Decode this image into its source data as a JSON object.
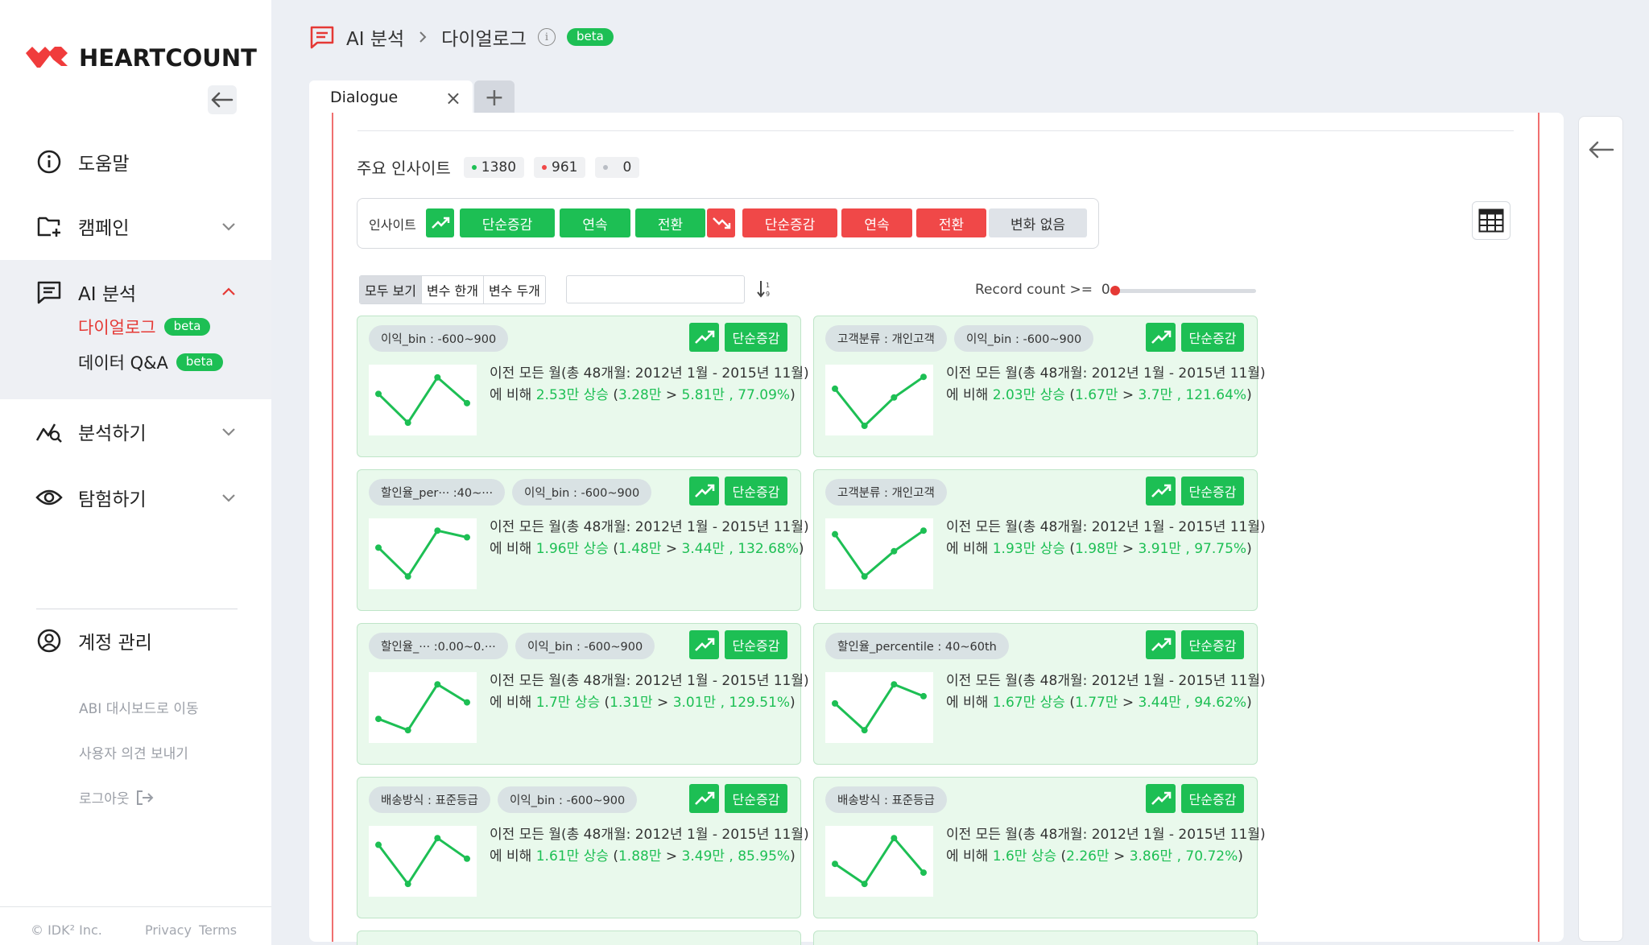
{
  "brand": {
    "name": "HEARTCOUNT",
    "red": "#f03c3c",
    "green": "#1dbf54"
  },
  "sidebar": {
    "items": [
      {
        "label": "도움말",
        "icon": "info-circle-icon"
      },
      {
        "label": "캠페인",
        "icon": "folder-plus-icon"
      },
      {
        "label": "AI 분석",
        "icon": "chat-icon"
      },
      {
        "label": "분석하기",
        "icon": "analytics-icon"
      },
      {
        "label": "탐험하기",
        "icon": "eye-icon"
      }
    ],
    "ai_sub": [
      {
        "label": "다이얼로그",
        "badge": "beta",
        "active": true
      },
      {
        "label": "데이터 Q&A",
        "badge": "beta",
        "active": false
      }
    ],
    "account": "계정 관리",
    "links": [
      "ABI 대시보드로 이동",
      "사용자 의견 보내기",
      "로그아웃"
    ],
    "footer": {
      "copyright": "© IDK² Inc.",
      "privacy": "Privacy",
      "terms": "Terms"
    }
  },
  "header": {
    "crumb1": "AI 분석",
    "crumb2": "다이얼로그",
    "badge": "beta"
  },
  "tabs": [
    {
      "label": "Dialogue"
    }
  ],
  "insights": {
    "title": "주요 인사이트",
    "counts": [
      {
        "value": "1380",
        "color": "#1dbf54"
      },
      {
        "value": "961",
        "color": "#f04848"
      },
      {
        "value": "0",
        "color": "#b9bdc4"
      }
    ],
    "filter_label": "인사이트",
    "up_filters": [
      "단순증감",
      "연속",
      "전환"
    ],
    "down_filters": [
      "단순증감",
      "연속",
      "전환"
    ],
    "none_filter": "변화 없음"
  },
  "toolbar": {
    "segments": [
      "모두 보기",
      "변수 한개",
      "변수 두개"
    ],
    "record_label": "Record count >=",
    "record_value": "0",
    "record_fraction": 0
  },
  "cards": [
    {
      "chips": [
        "이익_bin : -600~900"
      ],
      "type": "단순증감",
      "period": "이전 모든 월(총 48개월: 2012년 1월 - 2015년 11월)",
      "prefix": "에 비해 ",
      "change": "2.53만 상승",
      "open": " (",
      "from": "3.28만",
      "sep": " > ",
      "to": "5.81만 , 77.09%",
      "close": ")",
      "spark": [
        0.62,
        0.06,
        0.94,
        0.44
      ]
    },
    {
      "chips": [
        "고객분류 : 개인고객",
        "이익_bin : -600~900"
      ],
      "type": "단순증감",
      "period": "이전 모든 월(총 48개월: 2012년 1월 - 2015년 11월)",
      "prefix": "에 비해 ",
      "change": "2.03만 상승",
      "open": " (",
      "from": "1.67만",
      "sep": " > ",
      "to": "3.7만 , 121.64%",
      "close": ")",
      "spark": [
        0.72,
        0.0,
        0.55,
        0.95
      ]
    },
    {
      "chips": [
        "할인율_per···  :40~···",
        "이익_bin : -600~900"
      ],
      "type": "단순증감",
      "period": "이전 모든 월(총 48개월: 2012년 1월 - 2015년 11월)",
      "prefix": "에 비해 ",
      "change": "1.96만 상승",
      "open": " (",
      "from": "1.48만",
      "sep": " > ",
      "to": "3.44만 , 132.68%",
      "close": ")",
      "spark": [
        0.62,
        0.06,
        0.95,
        0.82
      ]
    },
    {
      "chips": [
        "고객분류 : 개인고객"
      ],
      "type": "단순증감",
      "period": "이전 모든 월(총 48개월: 2012년 1월 - 2015년 11월)",
      "prefix": "에 비해 ",
      "change": "1.93만 상승",
      "open": " (",
      "from": "1.98만",
      "sep": " > ",
      "to": "3.91만 , 97.75%",
      "close": ")",
      "spark": [
        0.88,
        0.06,
        0.55,
        0.95
      ]
    },
    {
      "chips": [
        "할인율_···  :0.00~0.···",
        "이익_bin : -600~900"
      ],
      "type": "단순증감",
      "period": "이전 모든 월(총 48개월: 2012년 1월 - 2015년 11월)",
      "prefix": "에 비해 ",
      "change": "1.7만 상승",
      "open": " (",
      "from": "1.31만",
      "sep": " > ",
      "to": "3.01만 , 129.51%",
      "close": ")",
      "spark": [
        0.28,
        0.06,
        0.95,
        0.6
      ]
    },
    {
      "chips": [
        "할인율_percentile : 40~60th"
      ],
      "type": "단순증감",
      "period": "이전 모든 월(총 48개월: 2012년 1월 - 2015년 11월)",
      "prefix": "에 비해 ",
      "change": "1.67만 상승",
      "open": " (",
      "from": "1.77만",
      "sep": " > ",
      "to": "3.44만 , 94.62%",
      "close": ")",
      "spark": [
        0.58,
        0.06,
        0.95,
        0.72
      ]
    },
    {
      "chips": [
        "배송방식 : 표준등급",
        "이익_bin : -600~900"
      ],
      "type": "단순증감",
      "period": "이전 모든 월(총 48개월: 2012년 1월 - 2015년 11월)",
      "prefix": "에 비해 ",
      "change": "1.61만 상승",
      "open": " (",
      "from": "1.88만",
      "sep": " > ",
      "to": "3.49만 , 85.95%",
      "close": ")",
      "spark": [
        0.82,
        0.06,
        0.95,
        0.55
      ]
    },
    {
      "chips": [
        "배송방식 : 표준등급"
      ],
      "type": "단순증감",
      "period": "이전 모든 월(총 48개월: 2012년 1월 - 2015년 11월)",
      "prefix": "에 비해 ",
      "change": "1.6만 상승",
      "open": " (",
      "from": "2.26만",
      "sep": " > ",
      "to": "3.86만 , 70.72%",
      "close": ")",
      "spark": [
        0.45,
        0.06,
        0.95,
        0.28
      ]
    }
  ]
}
